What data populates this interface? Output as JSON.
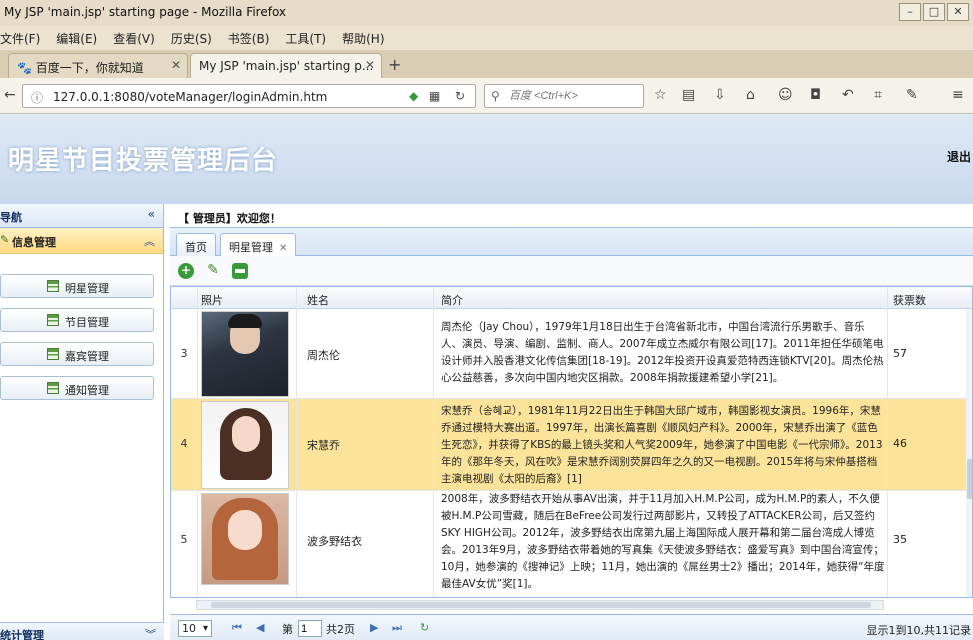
{
  "browser": {
    "window_title": "My JSP 'main.jsp' starting page - Mozilla Firefox",
    "menu": [
      "文件(F)",
      "编辑(E)",
      "查看(V)",
      "历史(S)",
      "书签(B)",
      "工具(T)",
      "帮助(H)"
    ],
    "tabs": [
      {
        "label": "百度一下，你就知道"
      },
      {
        "label": "My JSP 'main.jsp' starting p..."
      }
    ],
    "url": "127.0.0.1:8080/voteManager/loginAdmin.htm",
    "search_placeholder": "百度 <Ctrl+K>"
  },
  "app": {
    "title": "明星节目投票管理后台",
    "logout": "退出"
  },
  "sidebar": {
    "nav_title": "导航",
    "section": "信息管理",
    "items": [
      "明星管理",
      "节目管理",
      "嘉宾管理",
      "通知管理"
    ],
    "stats_title": "统计管理"
  },
  "main": {
    "welcome": "【 管理员】欢迎您！",
    "tabs": [
      "首页",
      "明星管理"
    ],
    "columns": [
      "照片",
      "姓名",
      "简介",
      "获票数"
    ],
    "rows": [
      {
        "num": "3",
        "name": "周杰伦",
        "intro": "周杰伦（Jay Chou），1979年1月18日出生于台湾省新北市，中国台湾流行乐男歌手、音乐人、演员、导演、编剧、监制、商人。2007年成立杰威尔有限公司[17]。2011年担任华硕笔电设计师并入股香港文化传信集团[18-19]。2012年投资开设真爱范特西连锁KTV[20]。周杰伦热心公益慈善，多次向中国内地灾区捐款。2008年捐款援建希望小学[21]。",
        "votes": "57"
      },
      {
        "num": "4",
        "name": "宋慧乔",
        "intro": "宋慧乔（송혜교），1981年11月22日出生于韩国大邱广域市，韩国影视女演员。1996年，宋慧乔通过模特大赛出道。1997年，出演长篇喜剧《顺风妇产科》。2000年，宋慧乔出演了《蓝色生死恋》，并获得了KBS的最上镜头奖和人气奖2009年，她参演了中国电影《一代宗师》。2013年的《那年冬天，风在吹》是宋慧乔阔别荧屏四年之久的又一电视剧。2015年将与宋仲基搭档主演电视剧《太阳的后裔》[1]",
        "votes": "46"
      },
      {
        "num": "5",
        "name": "波多野结衣",
        "intro": "2008年，波多野结衣开始从事AV出演，并于11月加入H.M.P公司，成为H.M.P的素人，不久便被H.M.P公司雪藏，随后在BeFree公司发行过两部影片，又转投了ATTACKER公司，后又签约SKY HIGH公司。2012年，波多野结衣出席第九届上海国际成人展开幕和第二届台湾成人博览会。2013年9月，波多野结衣带着她的写真集《天使波多野结衣：盛爱写真》到中国台湾宣传；10月，她参演的《搜神记》上映；11月，她出演的《屌丝男士2》播出；2014年，她获得“年度最佳AV女优”奖[1]。",
        "votes": "35"
      }
    ],
    "pager": {
      "page_size": "10",
      "page_label": "第",
      "page_value": "1",
      "total_pages": "共2页",
      "info": "显示1到10,共11记录"
    }
  }
}
